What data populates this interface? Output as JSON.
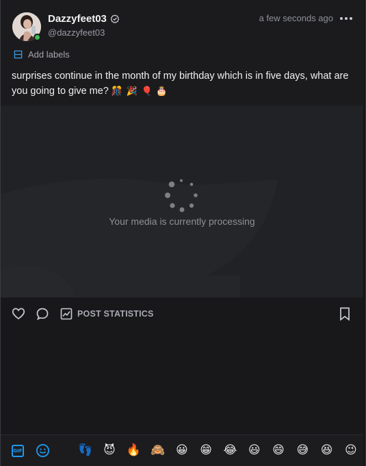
{
  "post": {
    "display_name": "Dazzyfeet03",
    "handle": "@dazzyfeet03",
    "timestamp": "a few seconds ago",
    "add_labels": "Add labels",
    "caption_text": "surprises continue in the month of my birthday which is in five days, what are you going to give me?",
    "caption_emojis": "🎊 🎉 🎈 🎂"
  },
  "media": {
    "processing_text": "Your media is currently processing"
  },
  "actions": {
    "stats_label": "POST STATISTICS"
  },
  "emoji_bar": {
    "gif_label": "GIF",
    "emojis": [
      "👣",
      "😈",
      "🔥",
      "🙈",
      "😀",
      "😁",
      "😂",
      "😃",
      "😄",
      "😅",
      "😆",
      "😉"
    ]
  },
  "colors": {
    "accent": "#1d9bf0",
    "online": "#3fb950"
  }
}
